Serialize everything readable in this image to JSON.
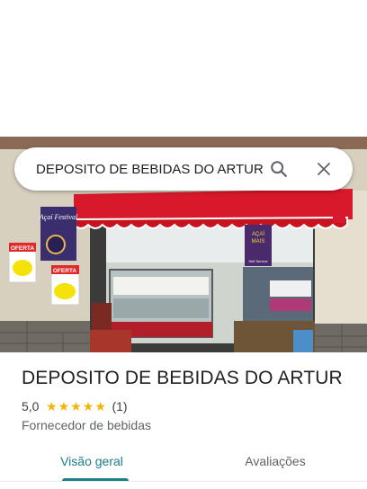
{
  "search": {
    "query": "DEPOSITO DE BEBIDAS DO ARTUR"
  },
  "photo": {
    "signs": {
      "oferta_1": "OFERTA",
      "oferta_2": "OFERTA",
      "poster_top": "Açaí Festival",
      "poster_right_1": "AÇAÍ",
      "poster_right_2": "MAIS",
      "poster_right_3": "Self Service"
    }
  },
  "place": {
    "name": "DEPOSITO DE BEBIDAS DO ARTUR",
    "rating": "5,0",
    "stars": 5,
    "review_count": "(1)",
    "category": "Fornecedor de bebidas"
  },
  "tabs": [
    {
      "label": "Visão geral",
      "active": true
    },
    {
      "label": "Avaliações",
      "active": false
    }
  ],
  "colors": {
    "accent": "#1a7f86",
    "star": "#f4b400",
    "awning": "#d7192b"
  },
  "icons": {
    "search": "search-icon",
    "close": "close-icon",
    "star": "star-icon"
  }
}
